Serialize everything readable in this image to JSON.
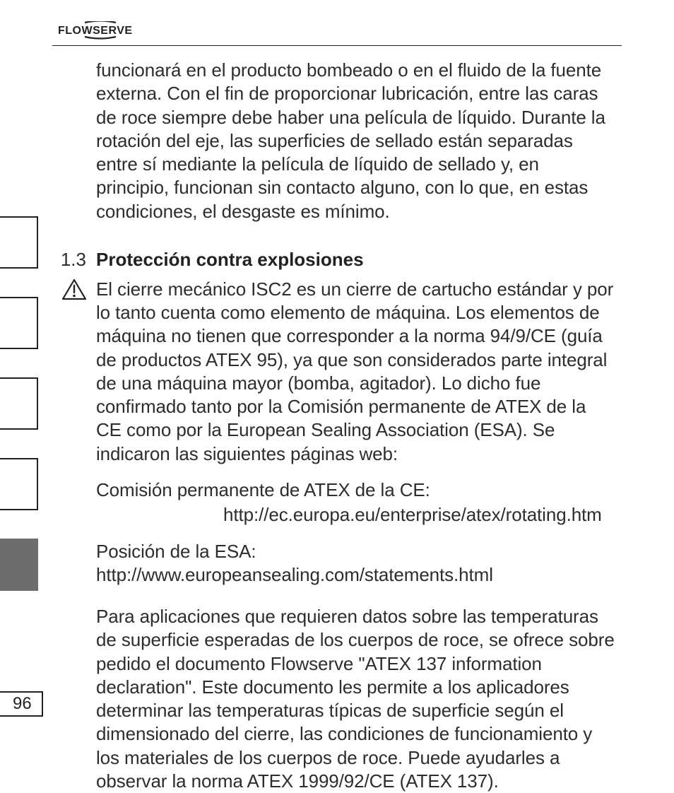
{
  "header": {
    "brand": "FLOWSERVE"
  },
  "pageNumber": "96",
  "content": {
    "para1": "funcionará en el producto bombeado o en el fluido de la fuente externa. Con el fin de proporcionar lubricación, entre las caras de roce siempre debe haber una película de líquido. Durante la rotación del eje, las superficies de sellado están separadas entre sí mediante la película de líquido de sellado y, en principio, fun­cionan sin contacto alguno, con lo que, en estas condiciones, el desgaste es mínimo.",
    "section": {
      "number": "1.3",
      "title": "Protección contra explosiones"
    },
    "para2": "El cierre mecánico ISC2 es un cierre de cartucho estándar y por lo tanto cuenta como elemento de máquina. Los elementos de máquina no tienen que corresponder a la norma 94/9/CE (guía de productos ATEX 95), ya que son considerados parte integral de una máquina mayor (bomba, agitador). Lo dicho fue confirmado tanto por la Comisión permanente de ATEX de la CE como por la European Sealing Association (ESA). Se indicaron las siguientes páginas web:",
    "para3_line1": "Comisión permanente de ATEX de la CE:",
    "para3_line2": "http://ec.europa.eu/enterprise/atex/rotating.htm",
    "para4": "Posición de la ESA: http://www.europeansealing.com/statements.html",
    "para5": "Para aplicaciones que requieren datos sobre las temperaturas de superficie esperadas de los cuerpos de roce, se ofrece sobre pedi­do el documento Flowserve \"ATEX 137 information declaration\". Este documento les permite a los aplicadores determinar las tem­peraturas típicas de superficie según el dimensionado del cierre, las condiciones de funcionamiento y los materiales de los cuerpos de roce. Puede ayudarles a observar la norma ATEX 1999/92/CE (ATEX 137)."
  }
}
